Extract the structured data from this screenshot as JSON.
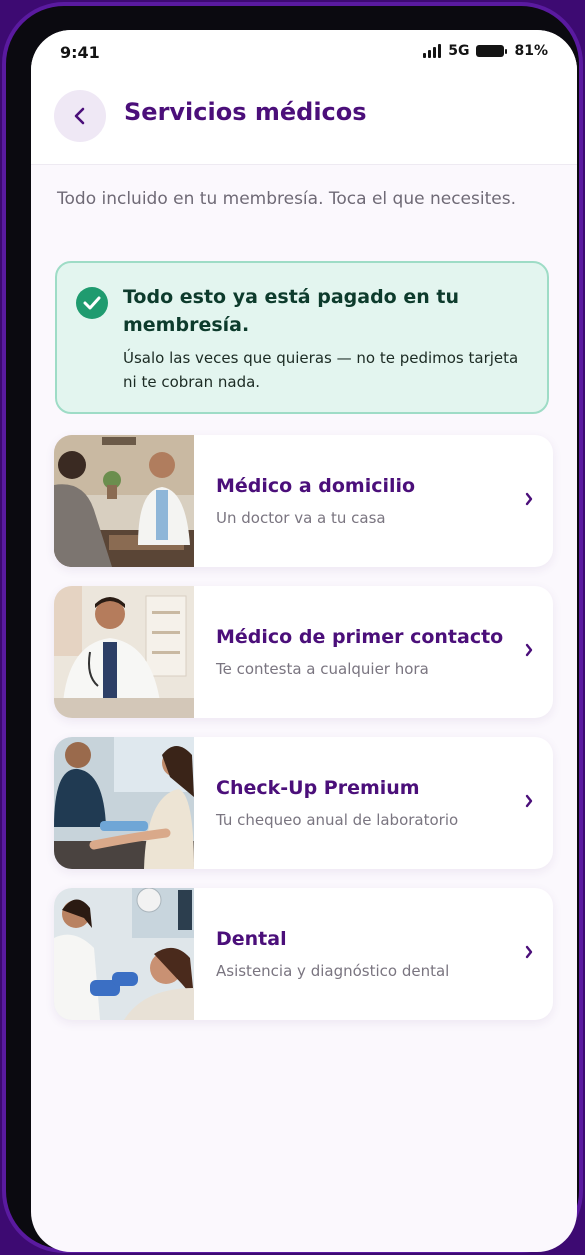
{
  "status_bar": {
    "time": "9:41",
    "network": "5G",
    "battery": "81%"
  },
  "header": {
    "title": "Servicios médicos"
  },
  "intro": "Todo incluido en tu membresía. Toca el que necesites.",
  "notice": {
    "title": "Todo esto ya está pagado en tu membresía.",
    "body": "Úsalo las veces que quieras — no te pedimos tarjeta ni te cobran nada."
  },
  "services": [
    {
      "title": "Médico a domicilio",
      "subtitle": "Un doctor va a tu casa",
      "image": "doctor-consultation-photo"
    },
    {
      "title": "Médico de primer contacto",
      "subtitle": "Te contesta a cualquier hora",
      "image": "smiling-doctor-photo"
    },
    {
      "title": "Check-Up Premium",
      "subtitle": "Tu chequeo anual de laboratorio",
      "image": "blood-test-photo"
    },
    {
      "title": "Dental",
      "subtitle": "Asistencia y diagnóstico dental",
      "image": "dentist-patient-photo"
    }
  ],
  "colors": {
    "primary": "#4b0f7a",
    "success": "#1f9b6f",
    "notice_bg": "#e3f5ef",
    "notice_border": "#9edcc6"
  }
}
